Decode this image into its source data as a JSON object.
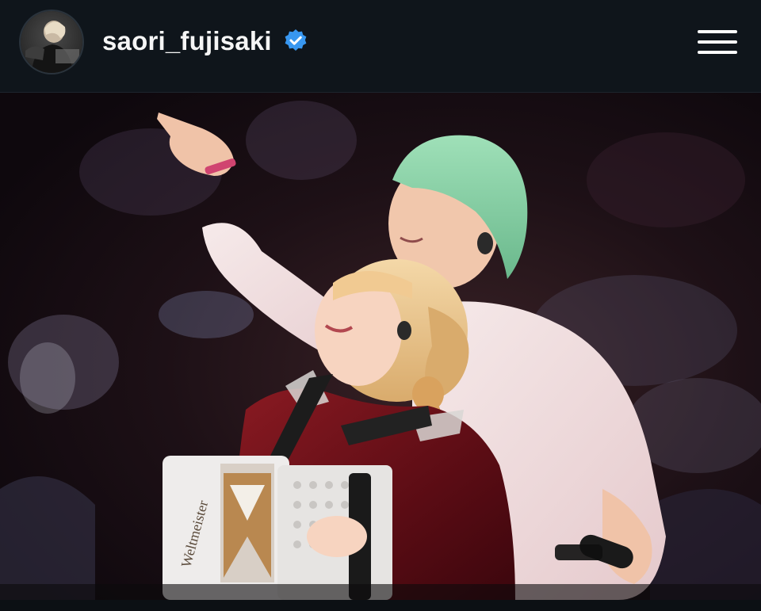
{
  "profile": {
    "username": "saori_fujisaki",
    "verified": true,
    "avatar_icon": "profile-photo-avatar",
    "verified_icon": "verified-badge-icon",
    "verified_color": "#3897f0"
  },
  "header": {
    "menu_icon": "hamburger-menu-icon",
    "background": "#0f151b"
  },
  "post": {
    "image_icon": "concert-stage-photo",
    "accordion_brand": "Weltmeister"
  }
}
